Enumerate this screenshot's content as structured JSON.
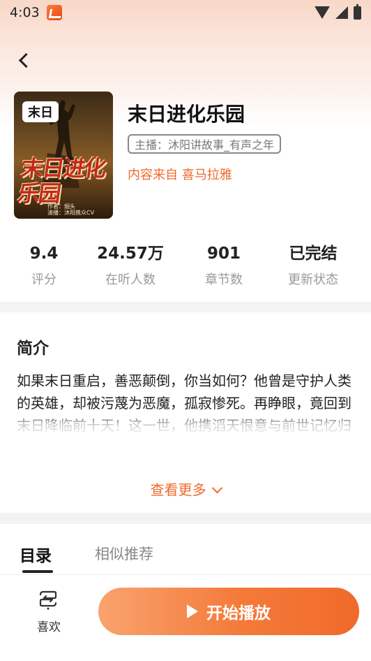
{
  "status_bar": {
    "time": "4:03"
  },
  "book": {
    "cover_tag": "末日",
    "cover_title_art": "末日进化乐园",
    "cover_credit_line1": "作者：烟头",
    "cover_credit_line2": "演播：沐阳携众CV",
    "title": "末日进化乐园",
    "narrator": "主播：沐阳讲故事_有声之年",
    "source": "内容来自 喜马拉雅"
  },
  "stats": [
    {
      "value": "9.4",
      "label": "评分"
    },
    {
      "value": "24.57万",
      "label": "在听人数"
    },
    {
      "value": "901",
      "label": "章节数"
    },
    {
      "value": "已完结",
      "label": "更新状态"
    }
  ],
  "intro": {
    "heading": "简介",
    "text": "如果末日重启，善恶颠倒，你当如何？他曾是守护人类的英雄，却被污蔑为恶魔，孤寂惨死。再睁眼，竟回到末日降临前十天！这一世，他携滔天恨意与前世记忆归来，誓要让所有背叛者付出代价，",
    "see_more": "查看更多"
  },
  "tabs": {
    "catalog": "目录",
    "similar": "相似推荐"
  },
  "bottom": {
    "like_label": "喜欢",
    "play_label": "开始播放"
  },
  "colors": {
    "accent": "#ef6a2c",
    "play_gradient_start": "#f9a36e",
    "play_gradient_end": "#f06a2a"
  }
}
